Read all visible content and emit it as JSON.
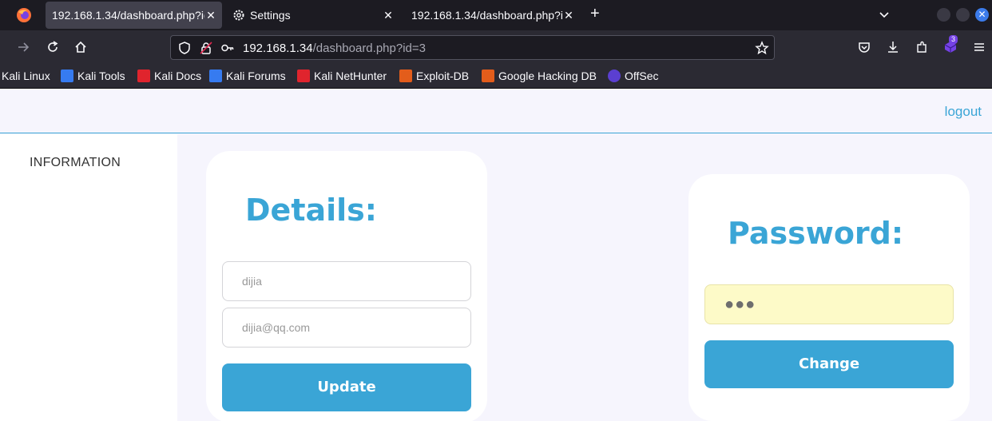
{
  "browser": {
    "tabs": [
      {
        "title": "192.168.1.34/dashboard.php?id=3",
        "active": true
      },
      {
        "title": "Settings",
        "active": false
      },
      {
        "title": "192.168.1.34/dashboard.php?id=3",
        "active": false
      }
    ],
    "url_host": "192.168.1.34",
    "url_path": "/dashboard.php?id=3",
    "extension_badge": "3",
    "bookmarks": [
      {
        "label": "Kali Linux",
        "icon": "kali-linux-icon",
        "color": "#2b2a33"
      },
      {
        "label": "Kali Tools",
        "icon": "kali-tools-icon",
        "color": "#367bf0"
      },
      {
        "label": "Kali Docs",
        "icon": "kali-docs-icon",
        "color": "#e0242d"
      },
      {
        "label": "Kali Forums",
        "icon": "kali-forums-icon",
        "color": "#367bf0"
      },
      {
        "label": "Kali NetHunter",
        "icon": "kali-nethunter-icon",
        "color": "#e0242d"
      },
      {
        "label": "Exploit-DB",
        "icon": "exploit-db-icon",
        "color": "#e35d1b"
      },
      {
        "label": "Google Hacking DB",
        "icon": "ghdb-icon",
        "color": "#e35d1b"
      },
      {
        "label": "OffSec",
        "icon": "offsec-icon",
        "color": "#5b3fd1"
      }
    ]
  },
  "page": {
    "logout_label": "logout",
    "sidebar_item": "INFORMATION",
    "details": {
      "title": "Details:",
      "name_value": "dijia",
      "email_value": "dijia@qq.com",
      "update_label": "Update"
    },
    "password": {
      "title": "Password:",
      "mask": "●●●",
      "change_label": "Change"
    },
    "accent_color": "#3aa5d6"
  }
}
